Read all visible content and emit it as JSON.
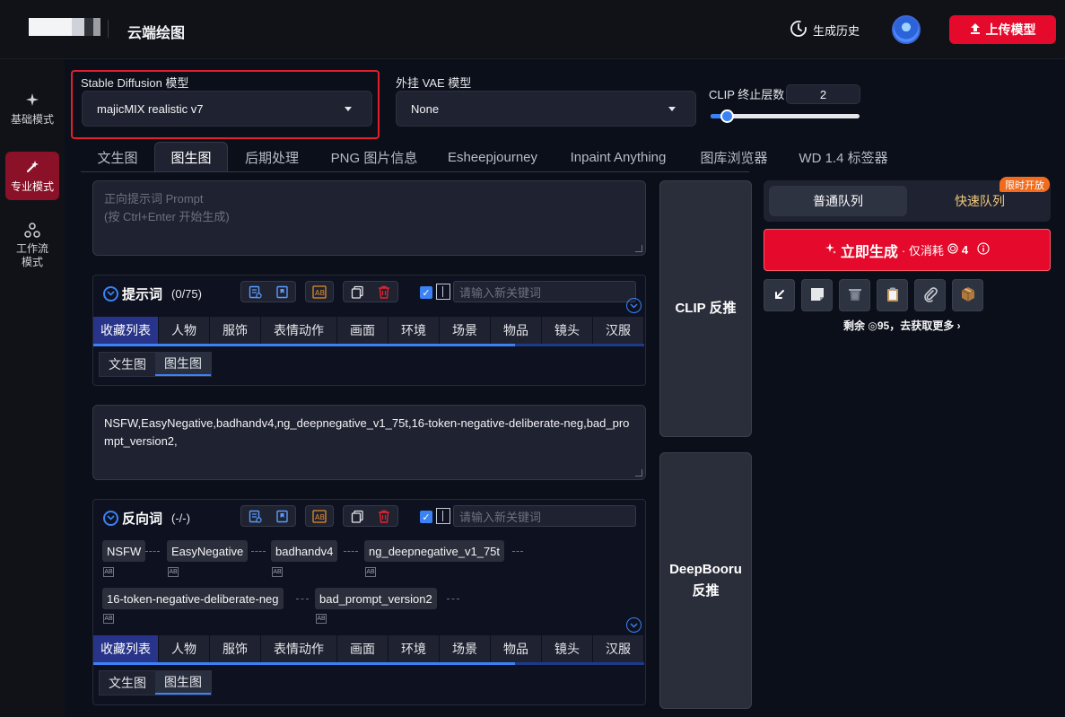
{
  "header": {
    "app_title": "云端绘图",
    "history_label": "生成历史",
    "upload_label": "上传模型"
  },
  "nav": {
    "items": [
      {
        "label": "基础模式"
      },
      {
        "label": "专业模式"
      },
      {
        "label": "工作流模式"
      }
    ]
  },
  "model": {
    "sd_label": "Stable Diffusion 模型",
    "sd_value": "majicMIX realistic v7",
    "vae_label": "外挂 VAE 模型",
    "vae_value": "None",
    "clip_label": "CLIP 终止层数",
    "clip_value": "2",
    "clip_fraction": 0.1
  },
  "tabs": [
    "文生图",
    "图生图",
    "后期处理",
    "PNG 图片信息",
    "Esheepjourney",
    "Inpaint Anything",
    "图库浏览器",
    "WD 1.4 标签器"
  ],
  "positive": {
    "placeholder_line1": "正向提示词 Prompt",
    "placeholder_line2": "(按 Ctrl+Enter 开始生成)",
    "title": "提示词",
    "count": "(0/75)",
    "keyword_placeholder": "请输入新关键词"
  },
  "categories": [
    "收藏列表",
    "人物",
    "服饰",
    "表情动作",
    "画面",
    "环境",
    "场景",
    "物品",
    "镜头",
    "汉服"
  ],
  "subtabs": [
    "文生图",
    "图生图"
  ],
  "negative": {
    "text": "NSFW,EasyNegative,badhandv4,ng_deepnegative_v1_75t,16-token-negative-deliberate-neg,bad_prompt_version2,",
    "title": "反向词",
    "count": "(-/-)",
    "keyword_placeholder": "请输入新关键词",
    "tags": [
      "NSFW",
      "EasyNegative",
      "badhandv4",
      "ng_deepnegative_v1_75t",
      "16-token-negative-deliberate-neg",
      "bad_prompt_version2"
    ]
  },
  "interrogate": {
    "clip": "CLIP 反推",
    "deepbooru_line1": "DeepBooru",
    "deepbooru_line2": "反推"
  },
  "queue": {
    "normal": "普通队列",
    "fast": "快速队列",
    "badge": "限时开放"
  },
  "generate": {
    "main": "立即生成",
    "sub": "· 仅消耗",
    "cost": "4"
  },
  "remaining": {
    "text": "剩余",
    "amount": "95",
    "link": "，去获取更多"
  },
  "colors": {
    "accent_red": "#e5092b",
    "accent_blue": "#3b82f6",
    "badge_orange": "#f26b1d",
    "fast_gold": "#f2c97d"
  }
}
